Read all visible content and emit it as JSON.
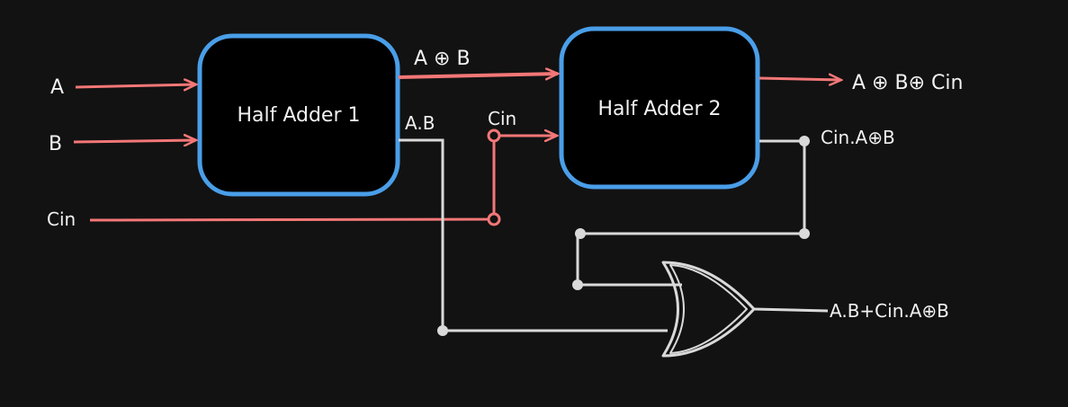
{
  "inputs": {
    "a": "A",
    "b": "B",
    "cin": "Cin"
  },
  "blocks": {
    "ha1": "Half Adder 1",
    "ha2": "Half Adder 2"
  },
  "signals": {
    "a_xor_b": "A ⊕ B",
    "ab": "A.B",
    "cin_to_ha2": "Cin",
    "sum": "A ⊕ B⊕ Cin",
    "cin_axorb": "Cin.A⊕B",
    "carry": "A.B+Cin.A⊕B"
  },
  "colors": {
    "background": "#121212",
    "block_border": "#4a9ee8",
    "block_fill": "#000000",
    "signal_red": "#f47777",
    "signal_gray": "#d9d9d9",
    "text": "#f2f2f2"
  }
}
